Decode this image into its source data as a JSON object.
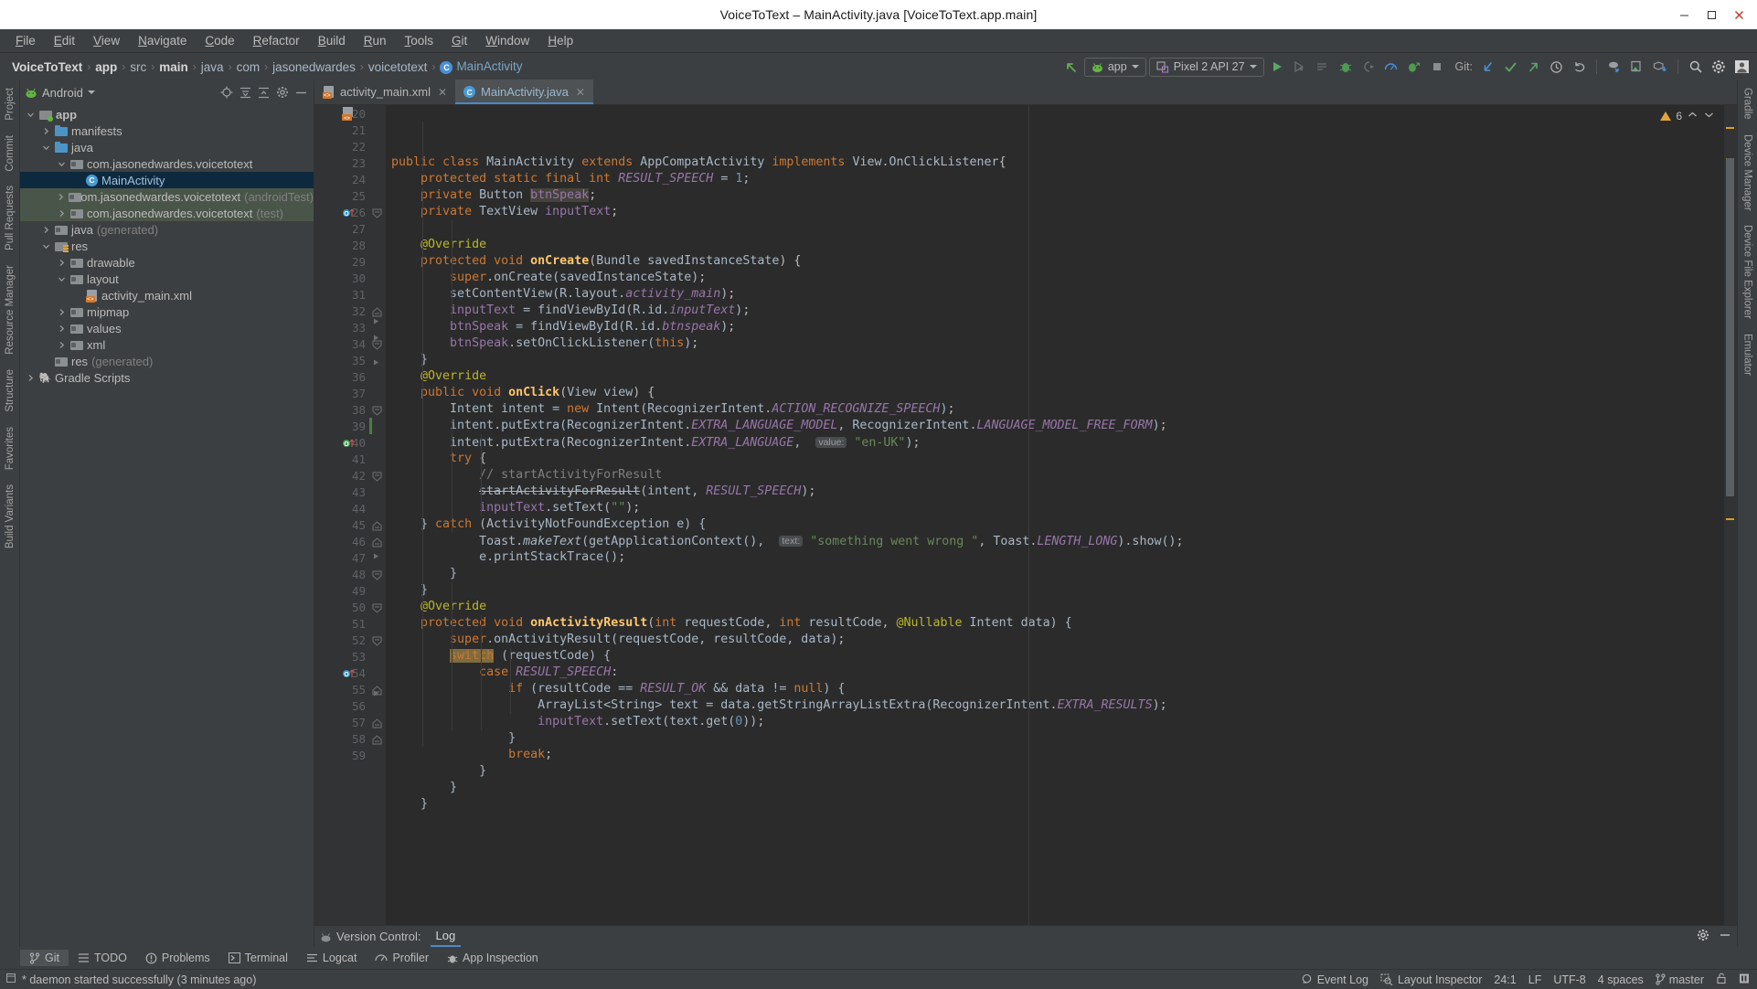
{
  "window": {
    "title": "VoiceToText – MainActivity.java [VoiceToText.app.main]",
    "minimize": "–",
    "maximize": "❐",
    "close": "✕"
  },
  "menubar": [
    "File",
    "Edit",
    "View",
    "Navigate",
    "Code",
    "Refactor",
    "Build",
    "Run",
    "Tools",
    "Git",
    "Window",
    "Help"
  ],
  "breadcrumbs": [
    {
      "label": "VoiceToText",
      "bold": true
    },
    {
      "label": "app",
      "bold": true
    },
    {
      "label": "src",
      "bold": false
    },
    {
      "label": "main",
      "bold": true
    },
    {
      "label": "java",
      "bold": false
    },
    {
      "label": "com",
      "bold": false
    },
    {
      "label": "jasonedwardes",
      "bold": false
    },
    {
      "label": "voicetotext",
      "bold": false
    },
    {
      "label": "MainActivity",
      "bold": false,
      "icon": "class-icon"
    }
  ],
  "toolbar": {
    "run_config": "app",
    "device": "Pixel 2 API 27",
    "git_label": "Git:",
    "icons": [
      "back-arrow-icon",
      "run-icon",
      "apply-changes-icon",
      "apply-code-changes-icon",
      "debug-icon",
      "attach-debugger-icon",
      "profiler-icon",
      "run-instant-icon",
      "stop-icon",
      "git-update-icon",
      "git-commit-icon",
      "git-push-icon",
      "history-icon",
      "undo-icon",
      "sdk-manager-icon",
      "avd-manager-icon",
      "gradle-sync-icon",
      "search-everywhere-icon",
      "settings-icon",
      "account-icon"
    ]
  },
  "project_panel": {
    "title": "Android",
    "actions": [
      "select-opened-file-icon",
      "expand-all-icon",
      "collapse-all-icon",
      "settings-icon",
      "hide-icon"
    ],
    "tree": [
      {
        "label": "app",
        "indent": 0,
        "arrow": "down",
        "icon": "module-folder",
        "bold": true
      },
      {
        "label": "manifests",
        "indent": 1,
        "arrow": "right",
        "icon": "folder"
      },
      {
        "label": "java",
        "indent": 1,
        "arrow": "down",
        "icon": "folder"
      },
      {
        "label": "com.jasonedwardes.voicetotext",
        "indent": 2,
        "arrow": "down",
        "icon": "package"
      },
      {
        "label": "MainActivity",
        "indent": 3,
        "arrow": "none",
        "icon": "class",
        "state": "selected"
      },
      {
        "label": "com.jasonedwardes.voicetotext",
        "suffix": " (androidTest)",
        "indent": 2,
        "arrow": "right",
        "icon": "package",
        "state": "green"
      },
      {
        "label": "com.jasonedwardes.voicetotext",
        "suffix": " (test)",
        "indent": 2,
        "arrow": "right",
        "icon": "package",
        "state": "green"
      },
      {
        "label": "java",
        "suffix": " (generated)",
        "indent": 1,
        "arrow": "right",
        "icon": "generated-folder"
      },
      {
        "label": "res",
        "indent": 1,
        "arrow": "down",
        "icon": "res-folder"
      },
      {
        "label": "drawable",
        "indent": 2,
        "arrow": "right",
        "icon": "package"
      },
      {
        "label": "layout",
        "indent": 2,
        "arrow": "down",
        "icon": "package"
      },
      {
        "label": "activity_main.xml",
        "indent": 3,
        "arrow": "none",
        "icon": "xml"
      },
      {
        "label": "mipmap",
        "indent": 2,
        "arrow": "right",
        "icon": "package"
      },
      {
        "label": "values",
        "indent": 2,
        "arrow": "right",
        "icon": "package"
      },
      {
        "label": "xml",
        "indent": 2,
        "arrow": "right",
        "icon": "package"
      },
      {
        "label": "res",
        "suffix": " (generated)",
        "indent": 1,
        "arrow": "none",
        "icon": "generated-folder"
      },
      {
        "label": "Gradle Scripts",
        "indent": 0,
        "arrow": "right",
        "icon": "gradle"
      }
    ]
  },
  "left_tool_strip": [
    "Project",
    "Commit",
    "Pull Requests",
    "Resource Manager",
    "Structure",
    "Favorites",
    "Build Variants"
  ],
  "right_tool_strip": [
    "Gradle",
    "Device Manager",
    "Device File Explorer",
    "Emulator"
  ],
  "editor": {
    "tabs": [
      {
        "label": "activity_main.xml",
        "icon": "xml-icon",
        "active": false
      },
      {
        "label": "MainActivity.java",
        "icon": "class-icon",
        "active": true
      }
    ],
    "warning_count": "6",
    "first_line_number": 20,
    "lines": [
      {
        "n": 20,
        "indent": 0
      },
      {
        "n": 21,
        "indent": 1
      },
      {
        "n": 22,
        "indent": 1
      },
      {
        "n": 23,
        "indent": 1
      },
      {
        "n": 24,
        "indent": 0
      },
      {
        "n": 25,
        "indent": 1
      },
      {
        "n": 26,
        "indent": 1
      },
      {
        "n": 27,
        "indent": 2
      },
      {
        "n": 28,
        "indent": 2
      },
      {
        "n": 29,
        "indent": 2
      },
      {
        "n": 30,
        "indent": 2
      },
      {
        "n": 31,
        "indent": 2
      },
      {
        "n": 32,
        "indent": 1
      },
      {
        "n": 33,
        "indent": 1
      },
      {
        "n": 34,
        "indent": 1
      },
      {
        "n": 35,
        "indent": 2
      },
      {
        "n": 36,
        "indent": 2
      },
      {
        "n": 37,
        "indent": 2
      },
      {
        "n": 38,
        "indent": 2
      },
      {
        "n": 39,
        "indent": 3
      },
      {
        "n": 40,
        "indent": 3
      },
      {
        "n": 41,
        "indent": 3
      },
      {
        "n": 42,
        "indent": 2
      },
      {
        "n": 43,
        "indent": 3
      },
      {
        "n": 44,
        "indent": 3
      },
      {
        "n": 45,
        "indent": 2
      },
      {
        "n": 46,
        "indent": 1
      },
      {
        "n": 47,
        "indent": 1
      },
      {
        "n": 48,
        "indent": 1
      },
      {
        "n": 49,
        "indent": 2
      },
      {
        "n": 50,
        "indent": 2
      },
      {
        "n": 51,
        "indent": 3
      },
      {
        "n": 52,
        "indent": 4
      },
      {
        "n": 53,
        "indent": 5
      },
      {
        "n": 54,
        "indent": 5
      },
      {
        "n": 55,
        "indent": 4
      },
      {
        "n": 56,
        "indent": 4
      },
      {
        "n": 57,
        "indent": 3
      },
      {
        "n": 58,
        "indent": 2
      },
      {
        "n": 59,
        "indent": 1
      }
    ],
    "source_text": [
      "public class MainActivity extends AppCompatActivity implements View.OnClickListener{",
      "    protected static final int RESULT_SPEECH = 1;",
      "    private Button btnSpeak;",
      "    private TextView inputText;",
      "",
      "    @Override",
      "    protected void onCreate(Bundle savedInstanceState) {",
      "        super.onCreate(savedInstanceState);",
      "        setContentView(R.layout.activity_main);",
      "        inputText = findViewById(R.id.inputText);",
      "        btnSpeak = findViewById(R.id.btnspeak);",
      "        btnSpeak.setOnClickListener(this);",
      "    }",
      "    @Override",
      "    public void onClick(View view) {",
      "        Intent intent = new Intent(RecognizerIntent.ACTION_RECOGNIZE_SPEECH);",
      "        intent.putExtra(RecognizerIntent.EXTRA_LANGUAGE_MODEL, RecognizerIntent.LANGUAGE_MODEL_FREE_FORM);",
      "        intent.putExtra(RecognizerIntent.EXTRA_LANGUAGE,  value: \"en-UK\");",
      "        try {",
      "            // startActivityForResult",
      "            startActivityForResult(intent, RESULT_SPEECH);",
      "            inputText.setText(\"\");",
      "        } catch (ActivityNotFoundException e) {",
      "            Toast.makeText(getApplicationContext(),  text: \"something went wrong \", Toast.LENGTH_LONG).show();",
      "            e.printStackTrace();",
      "        }",
      "    }",
      "    @Override",
      "    protected void onActivityResult(int requestCode, int resultCode, @Nullable Intent data) {",
      "        super.onActivityResult(requestCode, resultCode, data);",
      "        switch (requestCode) {",
      "            case RESULT_SPEECH:",
      "                if (resultCode == RESULT_OK && data != null) {",
      "                    ArrayList<String> text = data.getStringArrayListExtra(RecognizerIntent.EXTRA_RESULTS);",
      "                    inputText.setText(text.get(0));",
      "                }",
      "                break;",
      "        }",
      "    }",
      "}"
    ]
  },
  "vcs_panel": {
    "label": "Version Control:",
    "tab": "Log",
    "settings_icon": "gear-icon",
    "hide_icon": "minimize-icon"
  },
  "bottom_toolbar": [
    {
      "label": "Git",
      "icon": "git-branch-icon",
      "active": true
    },
    {
      "label": "TODO",
      "icon": "todo-icon",
      "active": false
    },
    {
      "label": "Problems",
      "icon": "problems-icon",
      "active": false
    },
    {
      "label": "Terminal",
      "icon": "terminal-icon",
      "active": false
    },
    {
      "label": "Logcat",
      "icon": "logcat-icon",
      "active": false
    },
    {
      "label": "Profiler",
      "icon": "profiler-icon",
      "active": false
    },
    {
      "label": "App Inspection",
      "icon": "app-inspection-icon",
      "active": false
    }
  ],
  "statusbar": {
    "message": "* daemon started successfully (3 minutes ago)",
    "event_log": "Event Log",
    "layout_inspector": "Layout Inspector",
    "caret_position": "24:1",
    "line_separator": "LF",
    "encoding": "UTF-8",
    "indent": "4 spaces",
    "branch": "master",
    "lock_icon": "unlocked-icon",
    "memory_icon": "inspection-icon"
  }
}
